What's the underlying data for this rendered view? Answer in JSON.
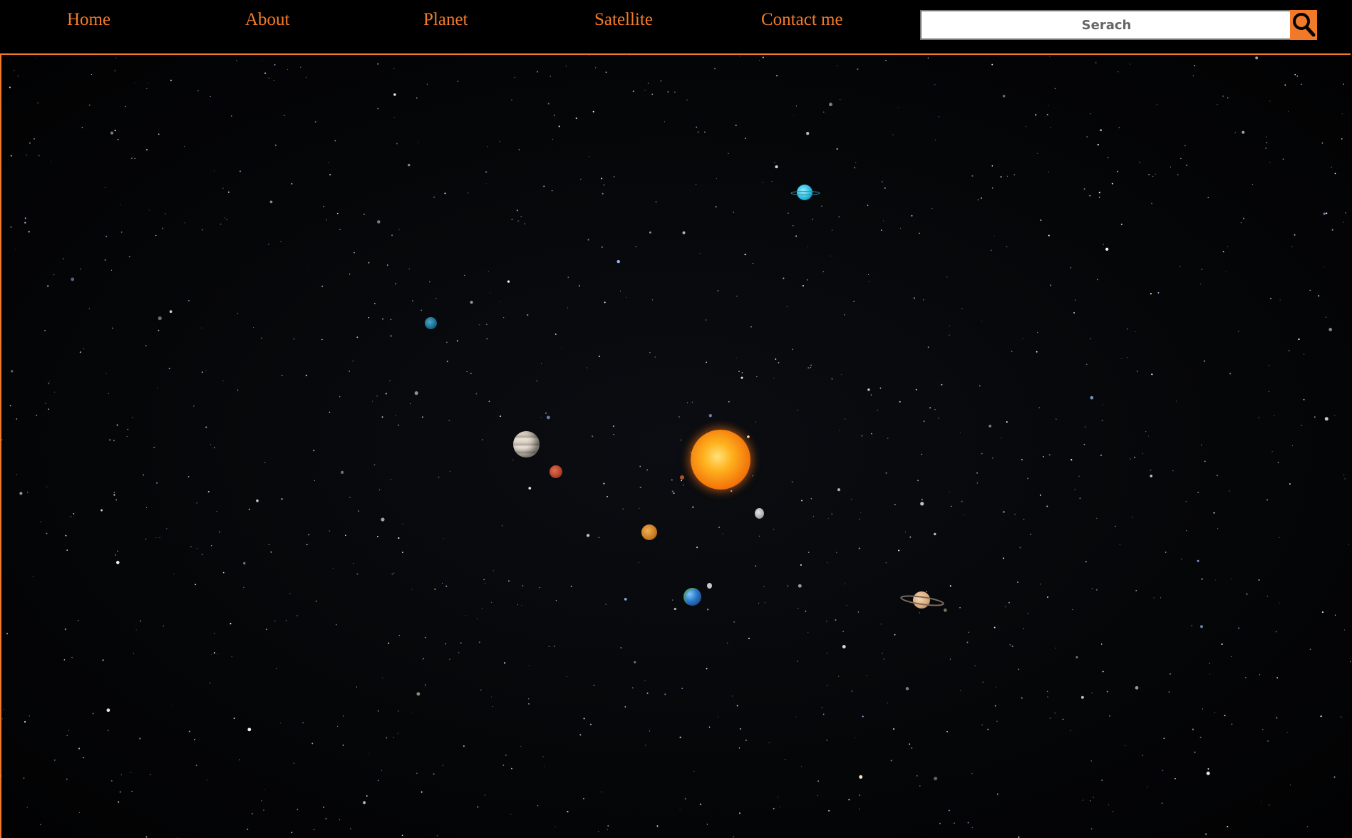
{
  "nav": {
    "items": [
      {
        "label": "Home"
      },
      {
        "label": "About"
      },
      {
        "label": "Planet"
      },
      {
        "label": "Satellite"
      },
      {
        "label": "Contact me"
      }
    ]
  },
  "search": {
    "placeholder": "Serach",
    "icon": "search-icon"
  },
  "colors": {
    "accent": "#f07a2a",
    "background": "#000000"
  },
  "scene": {
    "bodies": [
      "sun",
      "mercury",
      "venus",
      "earth",
      "moon",
      "mars",
      "jupiter",
      "saturn",
      "uranus",
      "neptune"
    ]
  }
}
